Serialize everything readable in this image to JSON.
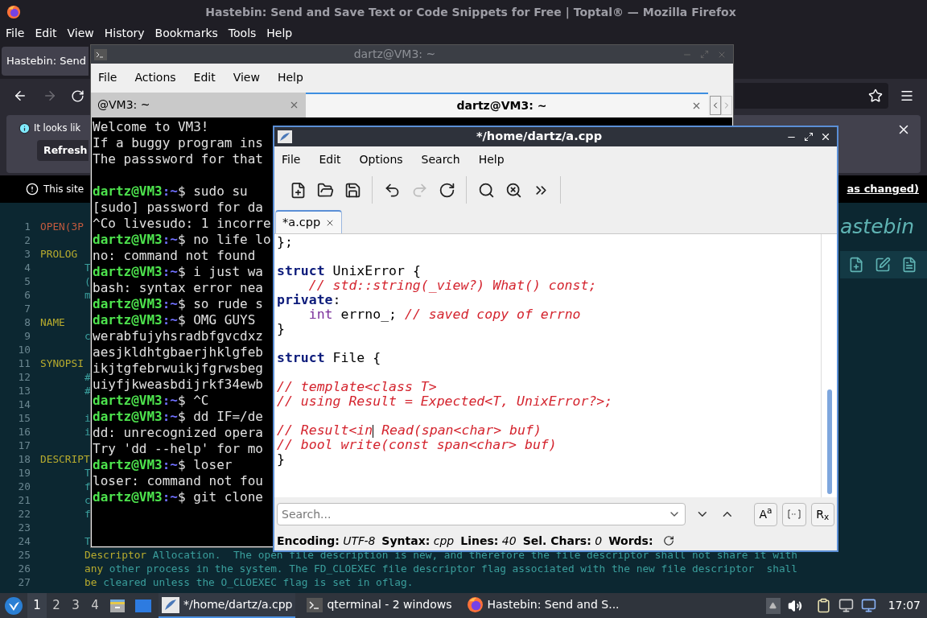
{
  "firefox": {
    "title": "Hastebin: Send and Save Text or Code Snippets for Free | Toptal® — Mozilla Firefox",
    "menu": [
      "File",
      "Edit",
      "View",
      "History",
      "Bookmarks",
      "Tools",
      "Help"
    ],
    "tab": {
      "label": "Hastebin: Send",
      "selected": true
    },
    "notice": {
      "text": "It looks lik",
      "button": "Refresh"
    },
    "warning": {
      "text": "This site",
      "link": "as changed)"
    }
  },
  "hastebin": {
    "logo": "astebin",
    "lines": [
      {
        "number": "1",
        "kind": "title",
        "text": "OPEN(3P"
      },
      {
        "number": "2",
        "kind": "empty"
      },
      {
        "number": "3",
        "kind": "heading",
        "text": "PROLOG"
      },
      {
        "number": "4",
        "kind": "body",
        "segments": [
          {
            "kind": "text",
            "text": "T"
          }
        ]
      },
      {
        "number": "5",
        "kind": "body",
        "segments": [
          {
            "kind": "text",
            "text": "("
          }
        ]
      },
      {
        "number": "6",
        "kind": "body",
        "segments": [
          {
            "kind": "text",
            "text": "m"
          }
        ]
      },
      {
        "number": "7",
        "kind": "empty"
      },
      {
        "number": "8",
        "kind": "heading",
        "text": "NAME"
      },
      {
        "number": "9",
        "kind": "body",
        "segments": [
          {
            "kind": "text",
            "text": "c"
          }
        ]
      },
      {
        "number": "10",
        "kind": "empty"
      },
      {
        "number": "11",
        "kind": "heading",
        "text": "SYNOPSI"
      },
      {
        "number": "12",
        "kind": "body",
        "segments": [
          {
            "kind": "text",
            "text": "#"
          }
        ]
      },
      {
        "number": "13",
        "kind": "body",
        "segments": [
          {
            "kind": "text",
            "text": "#"
          }
        ]
      },
      {
        "number": "14",
        "kind": "empty"
      },
      {
        "number": "15",
        "kind": "body",
        "segments": [
          {
            "kind": "text",
            "text": "i"
          }
        ]
      },
      {
        "number": "16",
        "kind": "body",
        "segments": [
          {
            "kind": "text",
            "text": "i"
          }
        ]
      },
      {
        "number": "17",
        "kind": "empty"
      },
      {
        "number": "18",
        "kind": "heading",
        "text": "DESCRIPT"
      },
      {
        "number": "19",
        "kind": "body",
        "segments": [
          {
            "kind": "text",
            "text": "T"
          }
        ]
      },
      {
        "number": "20",
        "kind": "body",
        "segments": [
          {
            "kind": "text",
            "text": "f"
          }
        ]
      },
      {
        "number": "21",
        "kind": "body",
        "segments": [
          {
            "kind": "text",
            "text": "c"
          }
        ]
      },
      {
        "number": "22",
        "kind": "body",
        "segments": [
          {
            "kind": "text",
            "text": "f"
          }
        ]
      },
      {
        "number": "23",
        "kind": "empty"
      },
      {
        "number": "24",
        "kind": "body",
        "segments": [
          {
            "kind": "text",
            "text": "T"
          }
        ]
      },
      {
        "number": "25",
        "kind": "body",
        "segments": [
          {
            "kind": "term",
            "text": "Descriptor"
          },
          {
            "kind": "text",
            "text": " Allocation.  The open file description is new, and therefore the file descriptor shall not share it with"
          }
        ]
      },
      {
        "number": "26",
        "kind": "body",
        "segments": [
          {
            "kind": "term",
            "text": "any"
          },
          {
            "kind": "text",
            "text": " other process in the system. The FD_CLOEXEC file descriptor flag associated with the new file descriptor  shall"
          }
        ]
      },
      {
        "number": "27",
        "kind": "body",
        "segments": [
          {
            "kind": "term",
            "text": "be"
          },
          {
            "kind": "text",
            "text": " cleared unless the O_CLOEXEC flag is set in oflag."
          }
        ]
      }
    ]
  },
  "terminal": {
    "title": "dartz@VM3: ~",
    "menu": [
      "File",
      "Actions",
      "Edit",
      "View",
      "Help"
    ],
    "tabs": [
      {
        "label": "@VM3: ~",
        "selected": false
      },
      {
        "label": "dartz@VM3: ~",
        "selected": true
      }
    ],
    "lines": [
      {
        "kind": "output",
        "text": "Welcome to VM3!"
      },
      {
        "kind": "output",
        "text": "If a buggy program ins"
      },
      {
        "kind": "output",
        "text": "The passsword for that"
      },
      {
        "kind": "blank"
      },
      {
        "kind": "prompt",
        "user": "dartz@VM3",
        "path": ":~",
        "command": "$ sudo su"
      },
      {
        "kind": "output",
        "text": "[sudo] password for da"
      },
      {
        "kind": "output",
        "text": "^Co livesudo: 1 incorre"
      },
      {
        "kind": "prompt",
        "user": "dartz@VM3",
        "path": ":~",
        "command": "$ no life lo"
      },
      {
        "kind": "output",
        "text": "no: command not found"
      },
      {
        "kind": "prompt",
        "user": "dartz@VM3",
        "path": ":~",
        "command": "$ i just wa"
      },
      {
        "kind": "output",
        "text": "bash: syntax error nea"
      },
      {
        "kind": "prompt",
        "user": "dartz@VM3",
        "path": ":~",
        "command": "$ so rude s"
      },
      {
        "kind": "prompt",
        "user": "dartz@VM3",
        "path": ":~",
        "command": "$ OMG GUYS"
      },
      {
        "kind": "output",
        "text": "werabfujyhsradbfgvcdxz"
      },
      {
        "kind": "output",
        "text": "aesjkldhtgbaerjhklgfeb"
      },
      {
        "kind": "output",
        "text": "ikjtgfebrwuikjfgrwsbeg"
      },
      {
        "kind": "output",
        "text": "uiyfjkweasbdijrkf34ewb"
      },
      {
        "kind": "prompt",
        "user": "dartz@VM3",
        "path": ":~",
        "command": "$ ^C"
      },
      {
        "kind": "prompt",
        "user": "dartz@VM3",
        "path": ":~",
        "command": "$ dd IF=/de"
      },
      {
        "kind": "output",
        "text": "dd: unrecognized opera"
      },
      {
        "kind": "output",
        "text": "Try 'dd --help' for mo"
      },
      {
        "kind": "prompt",
        "user": "dartz@VM3",
        "path": ":~",
        "command": "$ loser"
      },
      {
        "kind": "output",
        "text": "loser: command not fou"
      },
      {
        "kind": "prompt",
        "user": "dartz@VM3",
        "path": ":~",
        "command": "$ git clone"
      }
    ]
  },
  "editor": {
    "title": "*/home/dartz/a.cpp",
    "menu": [
      "File",
      "Edit",
      "Options",
      "Search",
      "Help"
    ],
    "toolbar": [
      {
        "disabled": false
      },
      {
        "disabled": false
      },
      {
        "disabled": false
      },
      {
        "disabled": false
      },
      {
        "disabled": true
      },
      {
        "disabled": false
      },
      {
        "disabled": false
      },
      {
        "disabled": false
      },
      {
        "disabled": false
      }
    ],
    "tab": {
      "label": "*a.cpp",
      "selected": true
    },
    "code": [
      {
        "kind": "code",
        "segments": [
          {
            "kind": "plain",
            "text": "};"
          }
        ]
      },
      {
        "kind": "blank"
      },
      {
        "kind": "code",
        "segments": [
          {
            "kind": "keyword",
            "text": "struct"
          },
          {
            "kind": "plain",
            "text": " UnixError {"
          }
        ]
      },
      {
        "kind": "indented",
        "segments": [
          {
            "kind": "comment",
            "text": "// std::string(_view?) What() const;"
          }
        ]
      },
      {
        "kind": "code",
        "segments": [
          {
            "kind": "keyword",
            "text": "private"
          },
          {
            "kind": "plain",
            "text": ":"
          }
        ]
      },
      {
        "kind": "indented",
        "segments": [
          {
            "kind": "type",
            "text": "int"
          },
          {
            "kind": "plain",
            "text": " errno_; "
          },
          {
            "kind": "comment",
            "text": "// saved copy of errno"
          }
        ]
      },
      {
        "kind": "code",
        "segments": [
          {
            "kind": "plain",
            "text": "}"
          }
        ]
      },
      {
        "kind": "blank"
      },
      {
        "kind": "code",
        "segments": [
          {
            "kind": "keyword",
            "text": "struct"
          },
          {
            "kind": "plain",
            "text": " File {"
          }
        ]
      },
      {
        "kind": "blank"
      },
      {
        "kind": "code",
        "segments": [
          {
            "kind": "comment",
            "text": "// template<class T>"
          }
        ]
      },
      {
        "kind": "code",
        "segments": [
          {
            "kind": "comment",
            "text": "// using Result = Expected<T, UnixError?>;"
          }
        ]
      },
      {
        "kind": "blank"
      },
      {
        "kind": "code",
        "segments": [
          {
            "kind": "comment",
            "text": "// Result<in"
          },
          {
            "kind": "cursor"
          },
          {
            "kind": "comment",
            "text": " Read(span<char> buf)"
          }
        ]
      },
      {
        "kind": "code",
        "segments": [
          {
            "kind": "comment",
            "text": "// bool write(const span<char> buf)"
          }
        ]
      },
      {
        "kind": "code",
        "segments": [
          {
            "kind": "plain",
            "text": "}"
          }
        ]
      }
    ],
    "search": {
      "placeholder": "Search...",
      "toggles": [
        {
          "kind": "text",
          "label": "A$^{a}$",
          "selected": false
        },
        {
          "kind": "icon",
          "selected": false
        },
        {
          "kind": "text",
          "label": "R$_{x}$",
          "selected": false
        }
      ]
    },
    "status": [
      {
        "label": "Encoding:",
        "value": "UTF-8"
      },
      {
        "label": "Syntax:",
        "value": "cpp"
      },
      {
        "label": "Lines:",
        "value": "40"
      },
      {
        "label": "Sel. Chars:",
        "value": "0"
      },
      {
        "label": "Words:"
      }
    ]
  },
  "taskbar": {
    "workspaces": [
      {
        "label": "1",
        "selected": true
      },
      {
        "label": "2",
        "selected": false
      },
      {
        "label": "3",
        "selected": false
      },
      {
        "label": "4",
        "selected": false
      }
    ],
    "tasks": [
      {
        "label": "*/home/dartz/a.cpp",
        "selected": true
      },
      {
        "label": "qterminal - 2 windows",
        "selected": false
      },
      {
        "label": "Hastebin: Send and S...",
        "selected": false
      }
    ],
    "clock": "17:07"
  }
}
